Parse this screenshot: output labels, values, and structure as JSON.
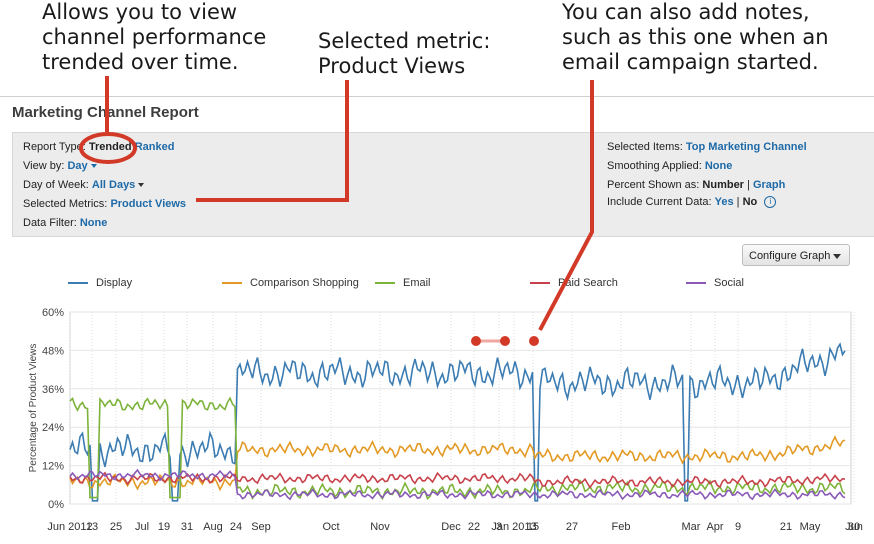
{
  "callouts": {
    "trend": "Allows you to view channel performance trended over time.",
    "metric": "Selected metric: Product Views",
    "notes": "You can also add notes, such as this one when an email campaign started."
  },
  "report": {
    "title": "Marketing Channel Report",
    "report_type_label": "Report Type:",
    "trended": "Trended",
    "ranked": "Ranked",
    "view_by_label": "View by:",
    "view_by_value": "Day",
    "day_of_week_label": "Day of Week:",
    "day_of_week_value": "All Days",
    "selected_metrics_label": "Selected Metrics:",
    "selected_metrics_value": "Product Views",
    "data_filter_label": "Data Filter:",
    "data_filter_value": "None",
    "selected_items_label": "Selected Items:",
    "selected_items_value": "Top Marketing Channel",
    "smoothing_label": "Smoothing Applied:",
    "smoothing_value": "None",
    "percent_label": "Percent Shown as:",
    "percent_number": "Number",
    "percent_sep": "|",
    "percent_graph": "Graph",
    "include_label": "Include Current Data:",
    "include_yes": "Yes",
    "include_sep": "|",
    "include_no": "No",
    "info_icon": "i",
    "configure_graph": "Configure Graph"
  },
  "colors": {
    "callout_red": "#d23a27",
    "display": "#3b7cb2",
    "comparison": "#e39a24",
    "email": "#7db33a",
    "paid": "#c8424b",
    "social": "#8a5ab8"
  },
  "chart_data": {
    "type": "line",
    "ylabel": "Percentage of Product Views",
    "yticks": [
      "60%",
      "48%",
      "36%",
      "24%",
      "12%",
      "0%"
    ],
    "ylim": [
      0,
      60
    ],
    "x_tick_labels": [
      "Jun 2012",
      "13",
      "25",
      "Jul",
      "19",
      "31",
      "Aug",
      "24",
      "Sep",
      "Oct",
      "Nov",
      "Dec",
      "22",
      "3",
      "Jan 2013",
      "15",
      "27",
      "Feb",
      "Mar",
      "Apr",
      "9",
      "21",
      "May",
      "Jun",
      "30"
    ],
    "grid": true,
    "legend_placement": "top",
    "series": [
      {
        "name": "Display",
        "color": "#3b7cb2"
      },
      {
        "name": "Comparison Shopping",
        "color": "#e39a24"
      },
      {
        "name": "Email",
        "color": "#7db33a"
      },
      {
        "name": "Paid Search",
        "color": "#c8424b"
      },
      {
        "name": "Social",
        "color": "#8a5ab8"
      }
    ],
    "segments": [
      {
        "range": "Jun 2012 to Aug 24",
        "display": 17,
        "comparison": 7,
        "email": 31,
        "paid": 8,
        "social": 9
      },
      {
        "range": "Aug 24 to Jan 2013",
        "display": 41,
        "comparison": 17,
        "email": 4,
        "paid": 8,
        "social": 3
      },
      {
        "range": "Jan 2013 to Jun",
        "display": 38,
        "comparison": 15,
        "email": 5,
        "paid": 7,
        "social": 3
      },
      {
        "range": "end (Jun)",
        "display": 48,
        "comparison": 19,
        "email": 5,
        "paid": 8,
        "social": 3
      }
    ],
    "annotations": [
      "note marker: email campaign start"
    ]
  }
}
